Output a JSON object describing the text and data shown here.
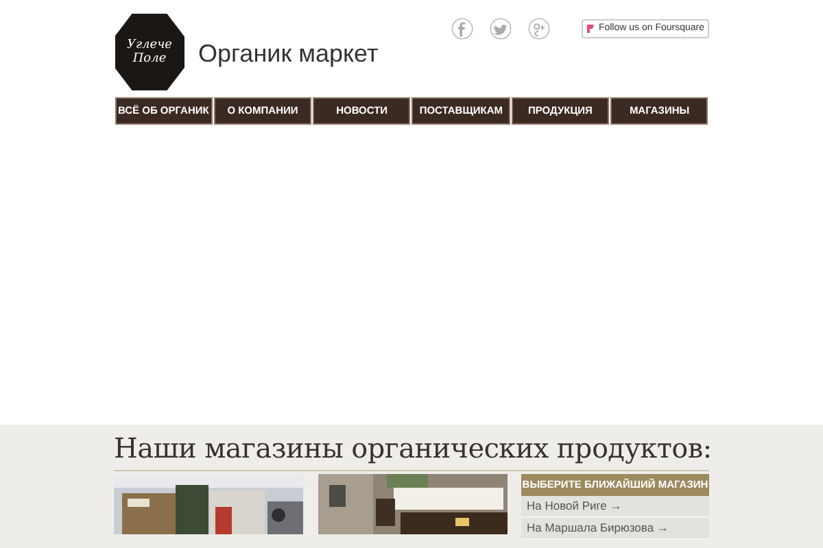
{
  "logo": {
    "line_1": "Углече",
    "line_2": "Поле"
  },
  "site_title": "Органик маркет",
  "social": [
    {
      "kind": "facebook"
    },
    {
      "kind": "twitter"
    },
    {
      "kind": "gplus"
    }
  ],
  "foursquare": {
    "label": "Follow us on Foursquare"
  },
  "nav": [
    {
      "label": "ВСЁ ОБ ОРГАНИК"
    },
    {
      "label": "О КОМПАНИИ"
    },
    {
      "label": "НОВОСТИ"
    },
    {
      "label": "ПОСТАВЩИКАМ"
    },
    {
      "label": "ПРОДУКЦИЯ"
    },
    {
      "label": "МАГАЗИНЫ"
    }
  ],
  "stores": {
    "heading": "Наши магазины органических продуктов:",
    "picker": {
      "title": "ВЫБЕРИТЕ БЛИЖАЙШИЙ МАГАЗИН",
      "items": [
        {
          "label": "На Новой Риге",
          "arrow": "→"
        },
        {
          "label": "На Маршала Бирюзова",
          "arrow": "→"
        }
      ]
    }
  }
}
